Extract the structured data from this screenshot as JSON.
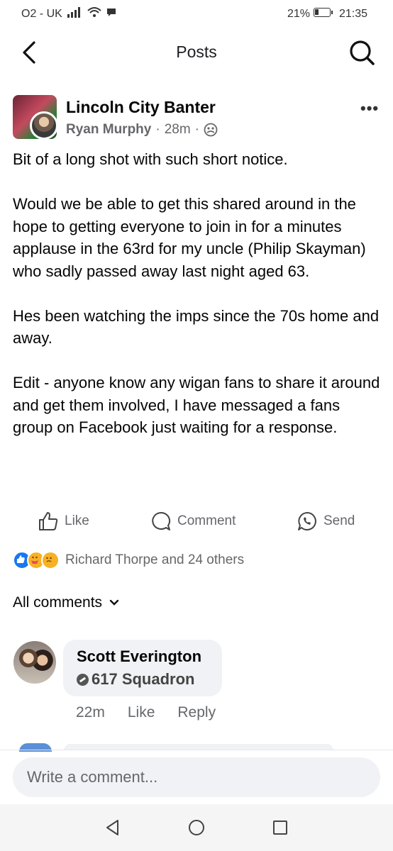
{
  "status_bar": {
    "carrier": "O2 - UK",
    "battery": "21%",
    "time": "21:35"
  },
  "header": {
    "title": "Posts",
    "back_icon": "chevron-left-icon",
    "search_icon": "search-icon"
  },
  "post": {
    "group_name": "Lincoln City Banter",
    "author": "Ryan Murphy",
    "time": "28m",
    "separator": "·",
    "privacy_icon": "group-icon",
    "more_label": "•••",
    "paragraphs": [
      "Bit of a long shot with such short notice.",
      "Would we be able to get this shared around in the hope to getting everyone to join in for a minutes applause in the 63rd for my uncle (Philip Skayman) who sadly passed away last night aged 63.",
      "Hes been watching the imps since the 70s home and away.",
      "Edit - anyone know any wigan fans to share it around and get them involved, I have messaged a fans group on Facebook just waiting for a response."
    ]
  },
  "actions": {
    "like": "Like",
    "comment": "Comment",
    "send": "Send"
  },
  "reactions": {
    "summary": "Richard Thorpe and 24 others",
    "types": [
      "like",
      "care",
      "sad"
    ],
    "colors": {
      "like": "#1877f2",
      "care": "#f7b125",
      "sad": "#f7b125"
    }
  },
  "comments_filter": {
    "label": "All comments"
  },
  "comment": {
    "name": "Scott Everington",
    "badge": "617 Squadron",
    "time": "22m",
    "like": "Like",
    "reply": "Reply"
  },
  "composer": {
    "placeholder": "Write a comment..."
  }
}
